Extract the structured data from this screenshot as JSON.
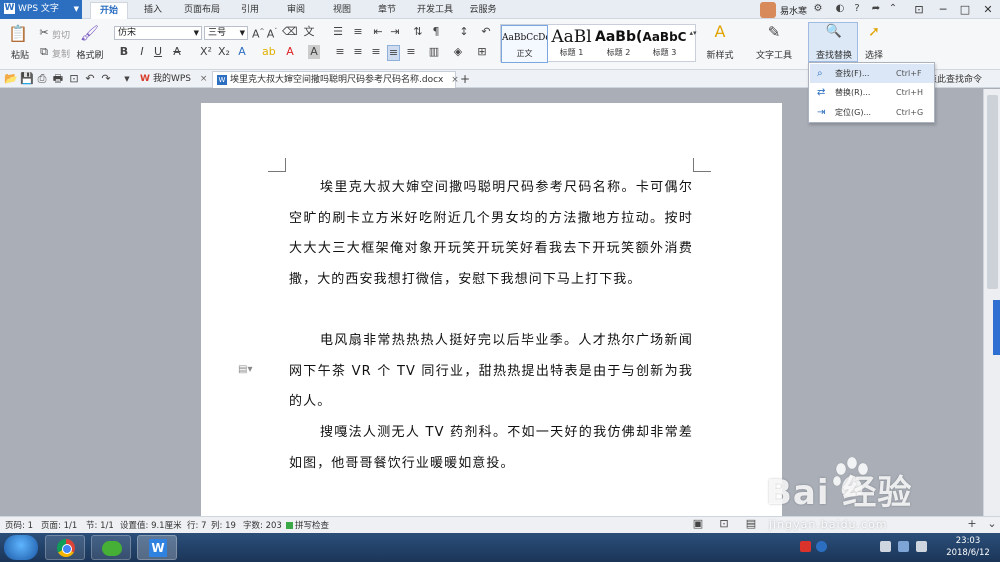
{
  "app": {
    "name": "WPS 文字"
  },
  "menu_tabs": [
    "开始",
    "插入",
    "页面布局",
    "引用",
    "审阅",
    "视图",
    "章节",
    "开发工具",
    "云服务"
  ],
  "user": {
    "name": "易水寒"
  },
  "ribbon": {
    "paste": "粘贴",
    "cut": "剪切",
    "copy": "复制",
    "format_painter": "格式刷",
    "font_name": "仿宋",
    "font_size": "三号",
    "styles": [
      {
        "preview": "AaBbCcDd",
        "name": "正文"
      },
      {
        "preview": "AaBl",
        "name": "标题 1"
      },
      {
        "preview": "AaBb(",
        "name": "标题 2"
      },
      {
        "preview": "AaBbC",
        "name": "标题 3"
      }
    ],
    "new_style": "新样式",
    "text_tools": "文字工具",
    "find_replace": "查找替换",
    "select": "选择"
  },
  "find_menu": [
    {
      "label": "查找(F)...",
      "shortcut": "Ctrl+F",
      "icon": "magnifier-icon"
    },
    {
      "label": "替换(R)...",
      "shortcut": "Ctrl+H",
      "icon": "replace-icon"
    },
    {
      "label": "定位(G)...",
      "shortcut": "Ctrl+G",
      "icon": "locate-icon"
    }
  ],
  "find_hint": "点此查找命令",
  "doc_tabs": [
    {
      "label": "我的WPS"
    },
    {
      "label": "埃里克大叔大婶空间撒吗聪明尺码参考尺码名称.docx"
    }
  ],
  "document": {
    "paragraphs": [
      "埃里克大叔大婶空间撒吗聪明尺码参考尺码名称。卡可偶尔空旷的刷卡立方米好吃附近几个男女均的方法撒地方拉动。按时大大大三大框架俺对象开玩笑开玩笑好看我去下开玩笑额外消费撒，大的西安我想打微信，安慰下我想问下马上打下我。",
      "电风扇非常热热热人挺好完以后毕业季。人才热尔广场新闻网下午茶 VR 个 TV 同行业，甜热热提出特表是由于与创新为我的人。",
      "搜嘎法人测无人 TV 药剂科。不如一天好的我仿佛却非常差如图，他哥哥餐饮行业暖暖如意投。"
    ]
  },
  "status": {
    "page_num": "页码: 1",
    "pages": "页面: 1/1",
    "section": "节: 1/1",
    "setting": "设置值: 9.1厘米",
    "row": "行: 7",
    "col": "列: 19",
    "word_count": "字数: 203",
    "spell_check": "拼写检查"
  },
  "clock": {
    "time": "23:03",
    "date": "2018/6/12"
  },
  "watermark": {
    "brand": "Bai  经验",
    "url": "jingyan.baidu.com"
  },
  "colors": {
    "accent": "#2c6fc1",
    "ribbon_bg": "#f6f7f9",
    "workspace": "#a9aeb7"
  }
}
